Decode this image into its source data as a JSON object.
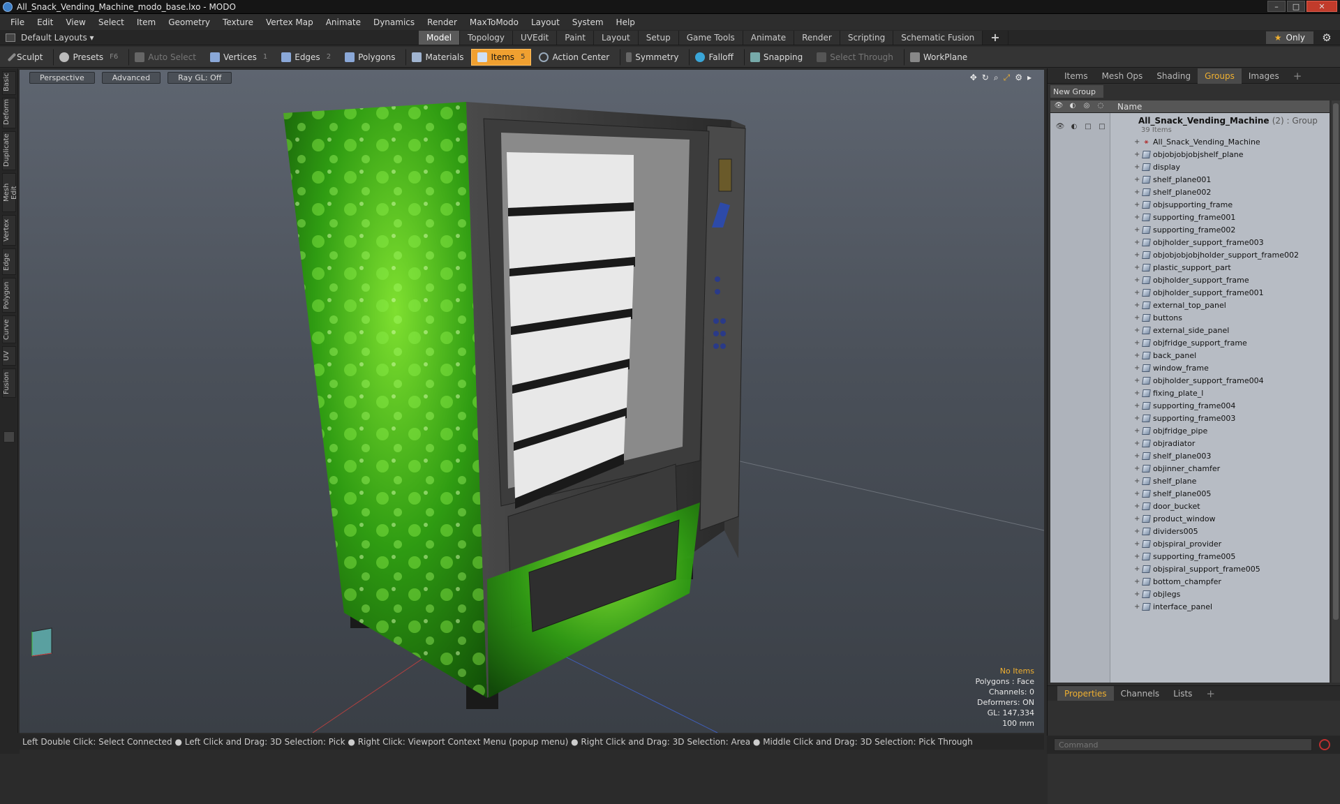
{
  "window": {
    "title": "All_Snack_Vending_Machine_modo_base.lxo - MODO",
    "controls": [
      "–",
      "□",
      "✕"
    ]
  },
  "menu": [
    "File",
    "Edit",
    "View",
    "Select",
    "Item",
    "Geometry",
    "Texture",
    "Vertex Map",
    "Animate",
    "Dynamics",
    "Render",
    "MaxToModo",
    "Layout",
    "System",
    "Help"
  ],
  "layoutbar": {
    "layout_label": "Default Layouts ▾",
    "tabs": [
      "Model",
      "Topology",
      "UVEdit",
      "Paint",
      "Layout",
      "Setup",
      "Game Tools",
      "Animate",
      "Render",
      "Scripting",
      "Schematic Fusion"
    ],
    "active_tab": "Model",
    "add_tab": "+",
    "only_label": "Only"
  },
  "toolbar": {
    "sculpt": "Sculpt",
    "presets": "Presets",
    "presets_key": "F6",
    "auto_select": "Auto Select",
    "vertices": "Vertices",
    "vertices_key": "1",
    "edges": "Edges",
    "edges_key": "2",
    "polygons": "Polygons",
    "materials": "Materials",
    "items": "Items",
    "items_key": "5",
    "action_center": "Action Center",
    "symmetry": "Symmetry",
    "falloff": "Falloff",
    "snapping": "Snapping",
    "select_through": "Select Through",
    "workplane": "WorkPlane"
  },
  "left_tabs": [
    "Basic",
    "Deform",
    "Duplicate",
    "Mesh Edit",
    "Vertex",
    "Edge",
    "Polygon",
    "Curve",
    "UV",
    "Fusion"
  ],
  "viewport": {
    "view_mode": "Perspective",
    "shading": "Advanced",
    "raygl": "Ray GL: Off",
    "info": {
      "no_items": "No Items",
      "polygons": "Polygons : Face",
      "channels": "Channels: 0",
      "deformers": "Deformers: ON",
      "gl": "GL: 147,334",
      "scale": "100 mm"
    }
  },
  "statusbar": "Left Double Click: Select Connected ● Left Click and Drag: 3D Selection: Pick ● Right Click: Viewport Context Menu (popup menu) ● Right Click and Drag: 3D Selection: Area ● Middle Click and Drag: 3D Selection: Pick Through",
  "right_panel": {
    "tabs": [
      "Items",
      "Mesh Ops",
      "Shading",
      "Groups",
      "Images"
    ],
    "active_tab": "Groups",
    "add_tab": "+",
    "new_group": "New Group",
    "name_header": "Name",
    "group": {
      "name": "All_Snack_Vending_Machine",
      "suffix": "(2) : Group",
      "count": "39 Items"
    },
    "items": [
      "All_Snack_Vending_Machine",
      "objobjobjobjshelf_plane",
      "display",
      "shelf_plane001",
      "shelf_plane002",
      "objsupporting_frame",
      "supporting_frame001",
      "supporting_frame002",
      "objholder_support_frame003",
      "objobjobjobjholder_support_frame002",
      "plastic_support_part",
      "objholder_support_frame",
      "objholder_support_frame001",
      "external_top_panel",
      "buttons",
      "external_side_panel",
      "objfridge_support_frame",
      "back_panel",
      "window_frame",
      "objholder_support_frame004",
      "fixing_plate_l",
      "supporting_frame004",
      "supporting_frame003",
      "objfridge_pipe",
      "objradiator",
      "shelf_plane003",
      "objinner_chamfer",
      "shelf_plane",
      "shelf_plane005",
      "door_bucket",
      "product_window",
      "dividers005",
      "objspiral_provider",
      "supporting_frame005",
      "objspiral_support_frame005",
      "bottom_champfer",
      "objlegs",
      "interface_panel"
    ],
    "bottom_tabs": [
      "Properties",
      "Channels",
      "Lists"
    ],
    "bottom_active": "Properties",
    "bottom_add": "+",
    "command_placeholder": "Command"
  }
}
